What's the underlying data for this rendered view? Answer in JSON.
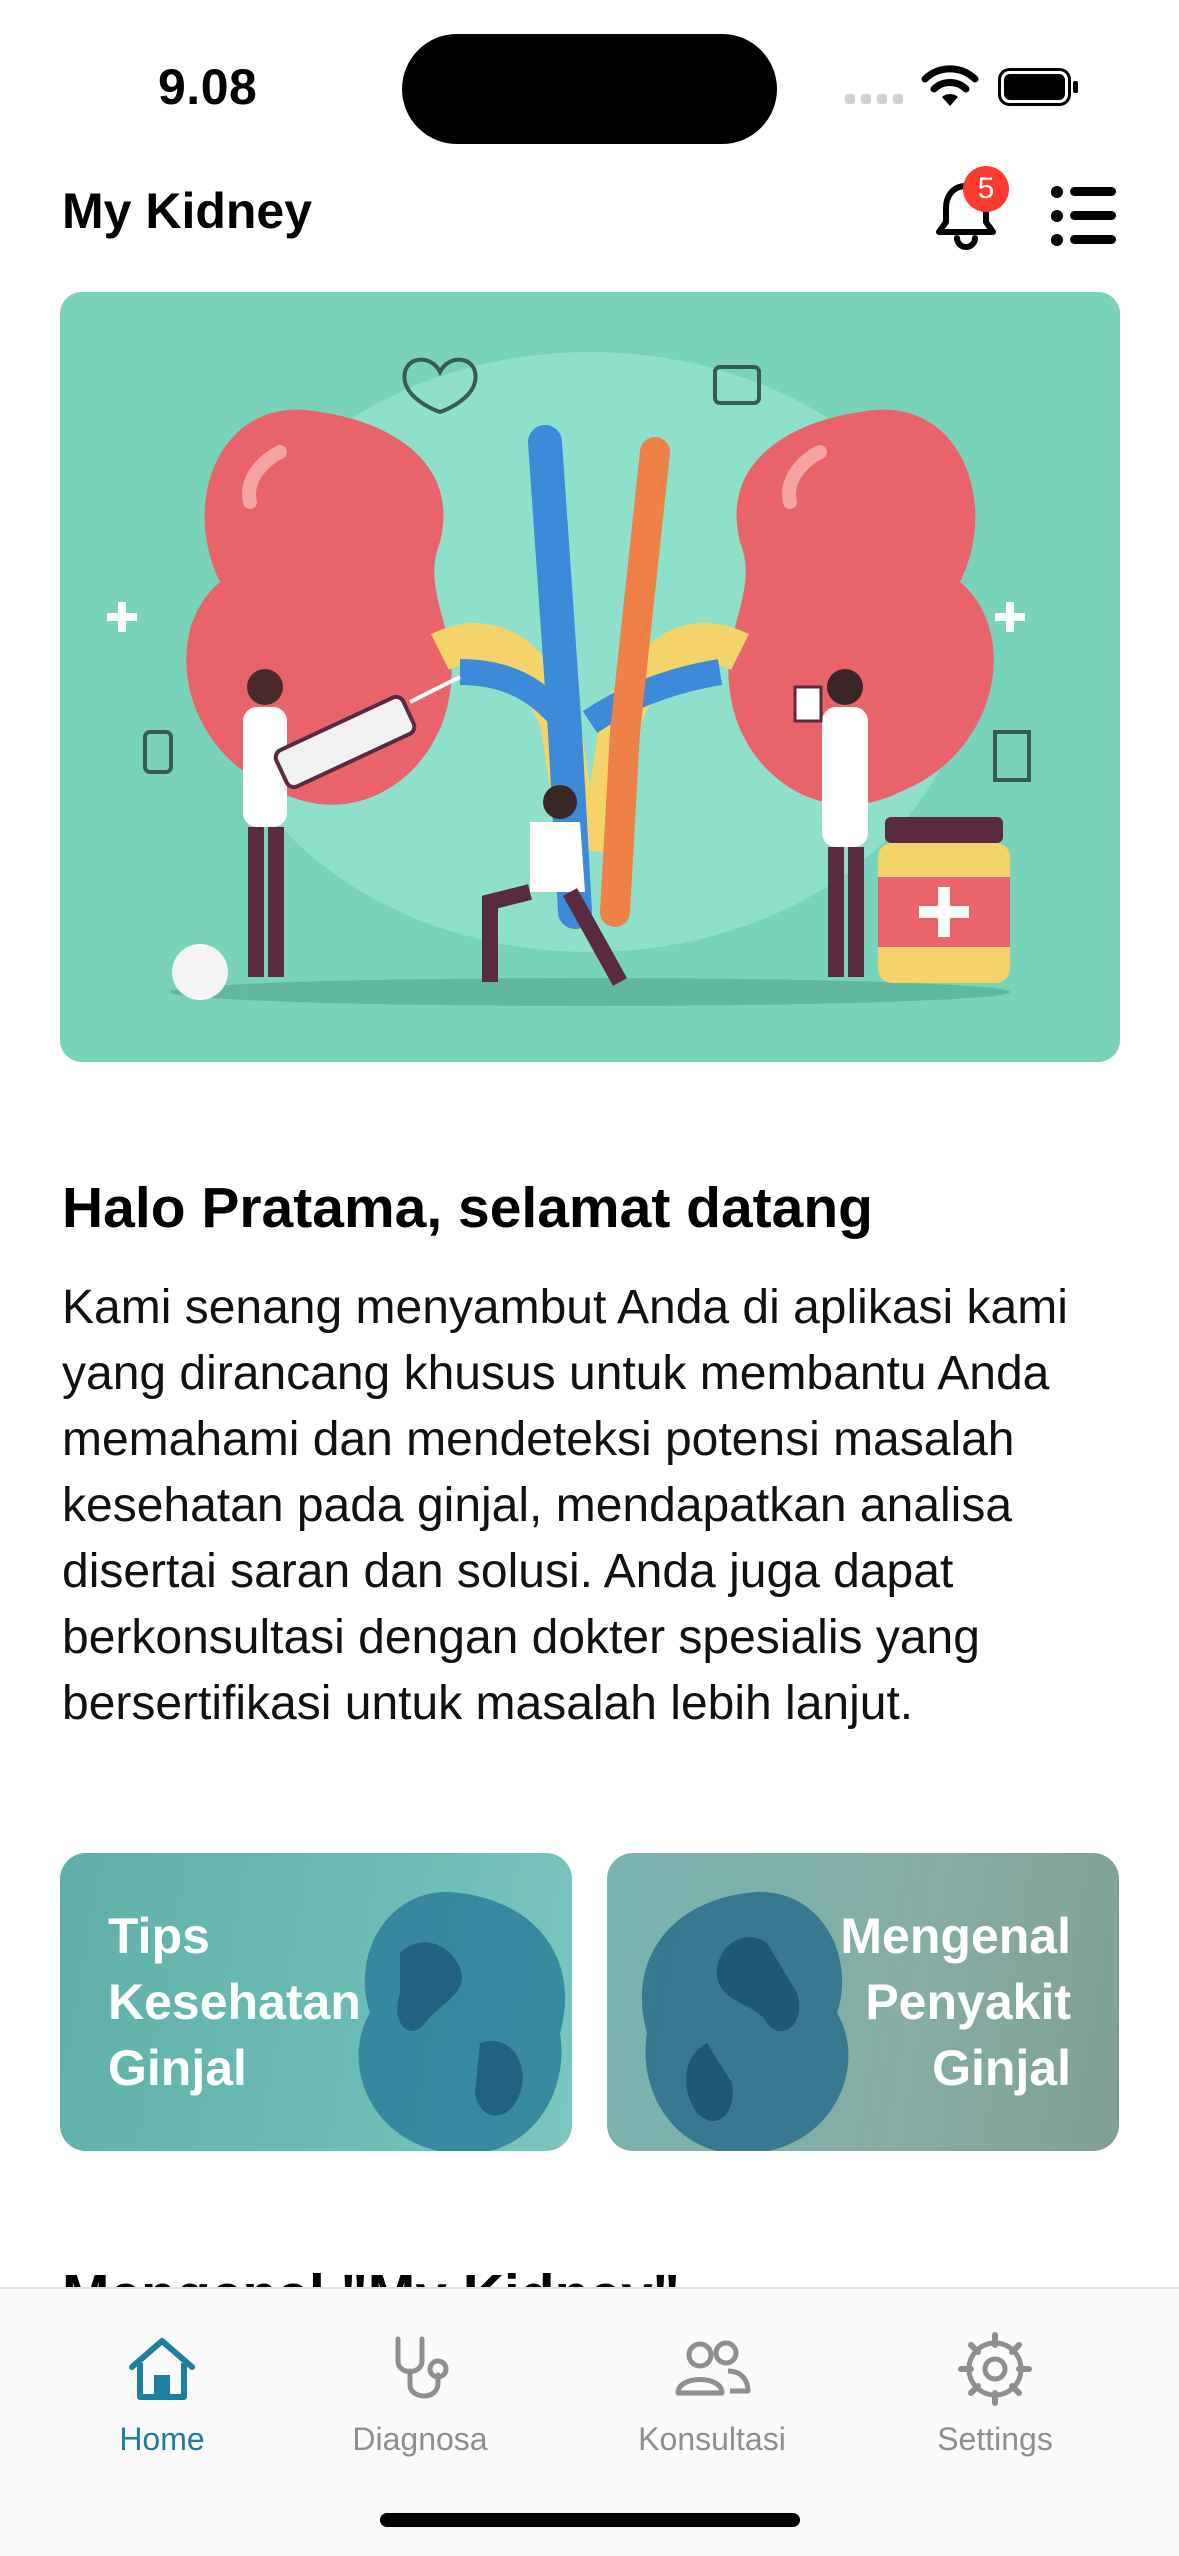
{
  "status_bar": {
    "time": "9.08"
  },
  "header": {
    "title": "My Kidney",
    "notification_count": "5"
  },
  "welcome": {
    "title": "Halo Pratama, selamat datang",
    "body": "Kami senang menyambut Anda di aplikasi kami yang dirancang khusus untuk membantu Anda memahami dan mendeteksi potensi masalah kesehatan pada ginjal, mendapatkan analisa disertai saran dan solusi. Anda juga dapat berkonsultasi dengan dokter spesialis yang bersertifikasi untuk masalah lebih lanjut."
  },
  "cards": [
    {
      "title": "Tips Kesehatan Ginjal"
    },
    {
      "title": "Mengenal Penyakit Ginjal"
    }
  ],
  "next_section_title": "Mengenal \"My Kidney\"",
  "tab_bar": {
    "items": [
      {
        "label": "Home",
        "icon": "home-icon",
        "active": true
      },
      {
        "label": "Diagnosa",
        "icon": "stethoscope-icon",
        "active": false
      },
      {
        "label": "Konsultasi",
        "icon": "people-icon",
        "active": false
      },
      {
        "label": "Settings",
        "icon": "gear-icon",
        "active": false
      }
    ]
  },
  "colors": {
    "accent": "#1a7fa0",
    "badge": "#ff3b30",
    "hero_bg": "#79d3bb",
    "inactive_tab": "#8e8e93"
  }
}
